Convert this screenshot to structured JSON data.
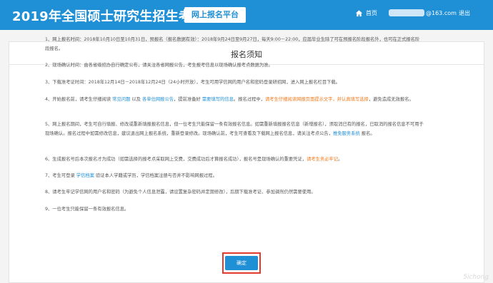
{
  "header": {
    "title": "2019年全国硕士研究生招生考试",
    "platform": "网上报名平台",
    "home": "首页",
    "email_suffix": "@163.com",
    "logout": "退出"
  },
  "card": {
    "title": "报名须知",
    "confirm": "确定"
  },
  "items": [
    {
      "runs": [
        {
          "t": "1、网上报名时间：2018年10月10日至10月31日，预报名（报名数据有效）：2018年9月24日至9月27日，每天9:00－22:00，应届毕业生除了可在预报名阶段报名外，也可在正式报名阶段报名。"
        }
      ]
    },
    {
      "runs": [
        {
          "t": "2、现场确认时间：由各省级招办自行确定公布，请关注各省网报公告，考生报考信息以现场确认报考点数据为准。"
        }
      ]
    },
    {
      "runs": [
        {
          "t": "3、下载准考证时间：2018年12月14日－2018年12月24日（24小时开放），考生可用学信网的用户名和密码登录研招网，进入网上报名栏目下载。"
        }
      ]
    },
    {
      "runs": [
        {
          "t": "4、开始报名前，请考生仔细阅读 "
        },
        {
          "t": "常见问题",
          "c": "link"
        },
        {
          "t": " 以及 "
        },
        {
          "t": "各单位网报公告",
          "c": "link"
        },
        {
          "t": "，提前准备好 "
        },
        {
          "t": "需要填写的信息",
          "c": "link"
        },
        {
          "t": "。报名过程中，"
        },
        {
          "t": "请考生仔细阅读网报页面提示文字，并认真填写选择",
          "c": "warn"
        },
        {
          "t": "，避免造成无效报名。"
        }
      ]
    },
    {
      "runs": [
        {
          "t": "5、网上报名期间，考生可自行填报、修改或重新填报报名信息，但一位考生只能保留一条有效报名信息。如需重新填报报名信息（新增报名），须取消已有的报名，已取消的报名信息不可用于现场确认。报名过程中如需修改信息，建议退出网上报名系统，重新登录修改。现场确认前，考生可查看及下载网上报名信息，请关注考点公告，"
        },
        {
          "t": "推免服务系统",
          "c": "link"
        },
        {
          "t": " 报名。"
        }
      ]
    },
    {
      "runs": [
        {
          "t": "6、生成报名号后本次报名才为成功（如需选择的报考点采取网上交费，交费成功后才算报名成功），报名号是现场确认的重要凭证，"
        },
        {
          "t": "请考生务必牢记",
          "c": "warn"
        },
        {
          "t": "。"
        }
      ]
    },
    {
      "runs": [
        {
          "t": "7、考生可登录 "
        },
        {
          "t": "学信档案",
          "c": "link"
        },
        {
          "t": " 验证本人学籍或学历，学信档案注册与否并不影响网报过程。"
        }
      ]
    },
    {
      "runs": [
        {
          "t": "8、请考生牢记学信网的用户名和密码（为避免个人信息泄露，请设置复杂密码并定期修改），后期下载准考证、参加调剂仍然需要使用。"
        }
      ]
    },
    {
      "runs": [
        {
          "t": "9、一位考生只能保留一条有效报名信息。"
        }
      ]
    }
  ],
  "watermark": "5ichong",
  "colors": {
    "primary": "#1f8fd6",
    "warning": "#f07a1c",
    "highlight": "#e33a2e"
  }
}
